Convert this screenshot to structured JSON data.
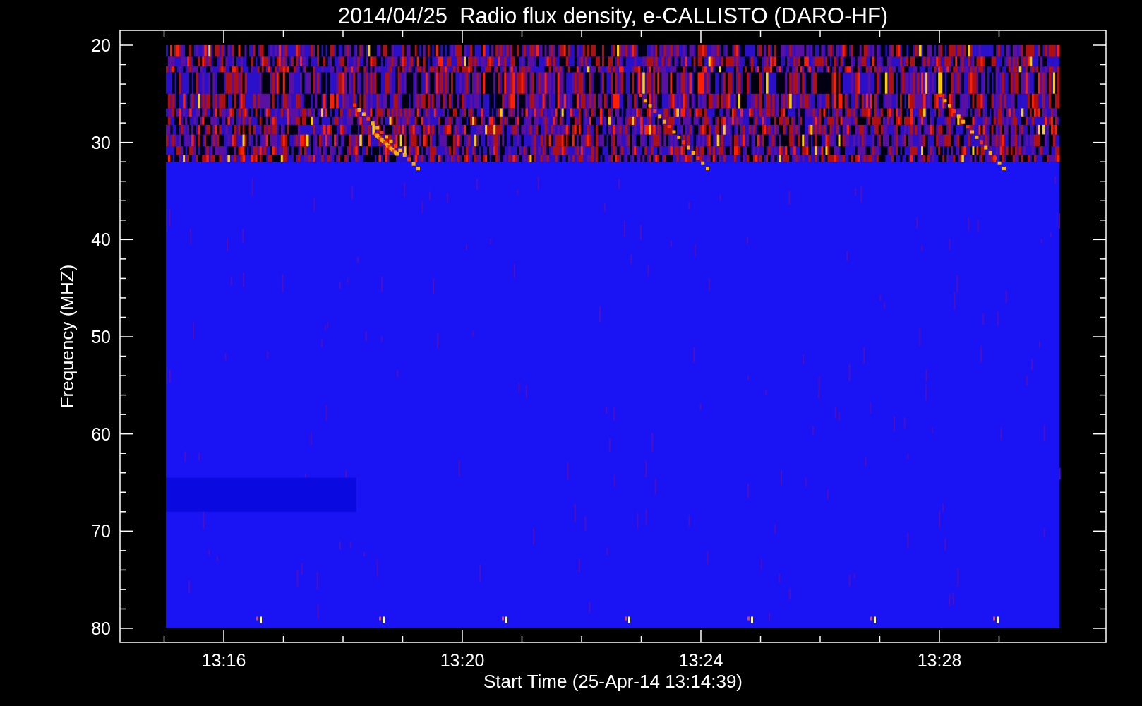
{
  "plot": {
    "title": "2014/04/25  Radio flux density, e-CALLISTO (DARO-HF)",
    "ylabel": "Frequency (MHZ)",
    "xlabel": "Start Time (25-Apr-14 13:14:39)",
    "y_tick_labels": [
      "20",
      "30",
      "40",
      "50",
      "60",
      "70",
      "80"
    ],
    "x_tick_labels": [
      "13:16",
      "13:20",
      "13:24",
      "13:28"
    ]
  }
}
